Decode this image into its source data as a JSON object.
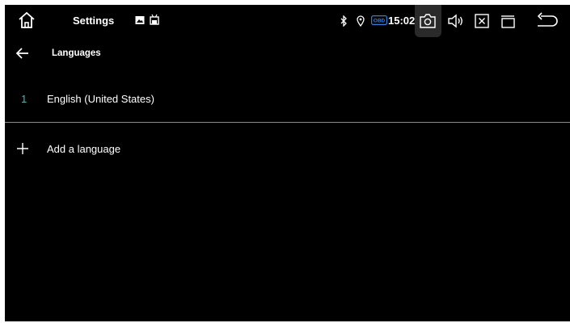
{
  "status_bar": {
    "app_title": "Settings",
    "time": "15:02",
    "obd_label": "OBD",
    "icons": [
      "home-icon",
      "image-notification-icon",
      "android-notification-icon",
      "bluetooth-icon",
      "location-icon",
      "obd-icon",
      "screenshot-icon",
      "volume-icon",
      "close-app-icon",
      "recent-apps-icon",
      "back-icon"
    ],
    "accent": "#4db6ac"
  },
  "header": {
    "title": "Languages"
  },
  "languages": [
    {
      "index": "1",
      "name": "English (United States)"
    }
  ],
  "add_language": {
    "label": "Add a language"
  }
}
